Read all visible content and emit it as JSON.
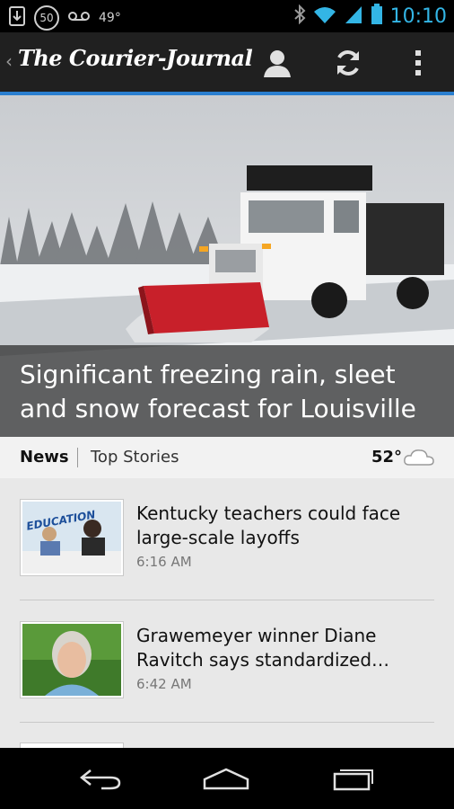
{
  "status_bar": {
    "badge_count": "50",
    "temperature": "49°",
    "clock": "10:10"
  },
  "action_bar": {
    "back_label": "‹",
    "logo_text": "The Courier-Journal"
  },
  "hero": {
    "title": "Significant freezing rain, sleet and snow forecast for Louisville"
  },
  "section_bar": {
    "section": "News",
    "subsection": "Top Stories",
    "weather_temp": "52°"
  },
  "stories": [
    {
      "title": "Kentucky teachers could face large-scale layoffs",
      "time": "6:16 AM",
      "thumb_text": "EDUCATION"
    },
    {
      "title": "Grawemeyer winner Diane Ravitch says standardized…",
      "time": "6:42 AM"
    }
  ],
  "colors": {
    "accent_blue": "#2a7fd0",
    "clock_blue": "#33b5e5",
    "plow_red": "#c8202a"
  }
}
